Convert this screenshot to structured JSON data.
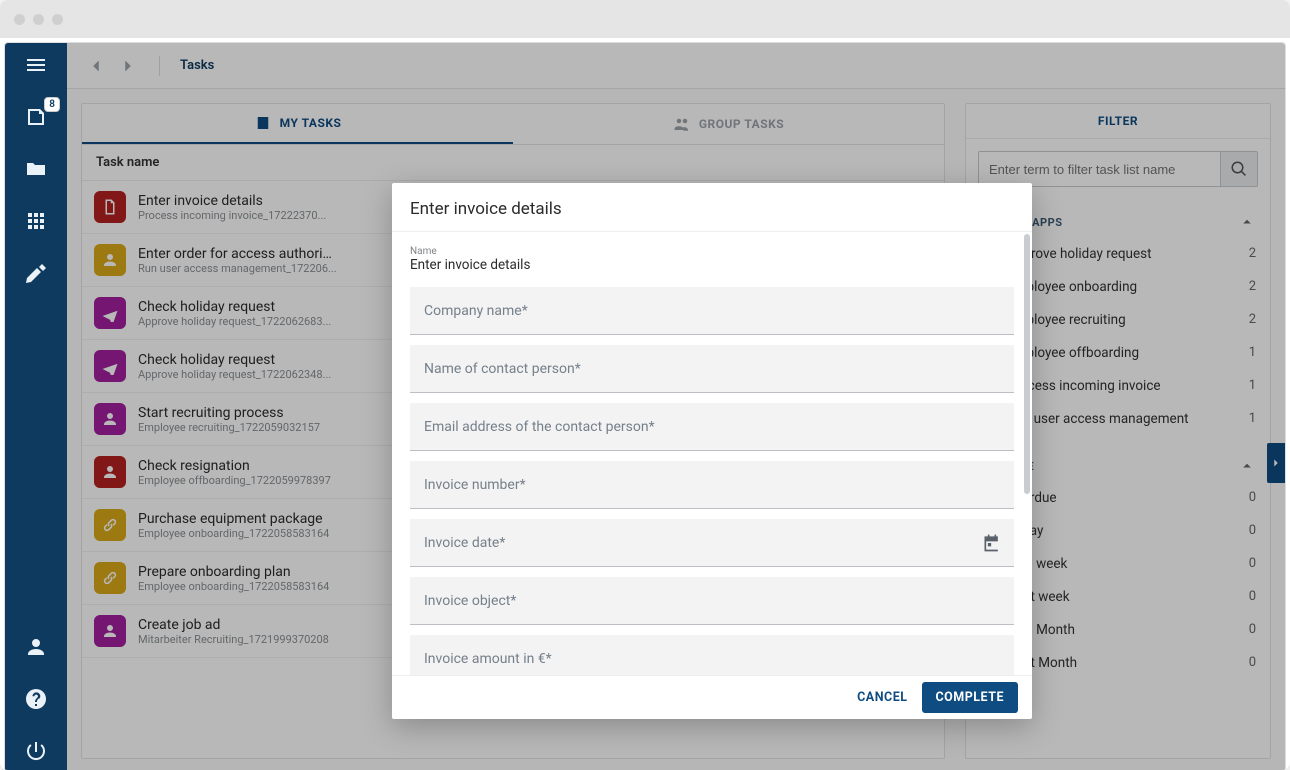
{
  "breadcrumb": "Tasks",
  "sidebar_badge": "8",
  "tabs": {
    "my_tasks": "MY TASKS",
    "group_tasks": "GROUP TASKS"
  },
  "column_header": "Task name",
  "tasks": [
    {
      "title": "Enter invoice details",
      "sub": "Process incoming invoice_17222370...",
      "color": "#b32121",
      "icon": "doc"
    },
    {
      "title": "Enter order for access authorizat...",
      "sub": "Run user access management_172206...",
      "color": "#d9a818",
      "icon": "user"
    },
    {
      "title": "Check holiday request",
      "sub": "Approve holiday request_1722062683...",
      "color": "#a11f9e",
      "icon": "plane"
    },
    {
      "title": "Check holiday request",
      "sub": "Approve holiday request_1722062348...",
      "color": "#a11f9e",
      "icon": "plane"
    },
    {
      "title": "Start recruiting process",
      "sub": "Employee recruiting_1722059032157",
      "color": "#a11f9e",
      "icon": "user"
    },
    {
      "title": "Check resignation",
      "sub": "Employee offboarding_1722059978397",
      "color": "#b32121",
      "icon": "user"
    },
    {
      "title": "Purchase equipment package",
      "sub": "Employee onboarding_1722058583164",
      "color": "#d9a818",
      "icon": "link"
    },
    {
      "title": "Prepare onboarding plan",
      "sub": "Employee onboarding_1722058583164",
      "color": "#d9a818",
      "icon": "link"
    },
    {
      "title": "Create job ad",
      "sub": "Mitarbeiter Recruiting_1721999370208",
      "color": "#a11f9e",
      "icon": "user"
    }
  ],
  "filter": {
    "header": "FILTER",
    "search_placeholder": "Enter term to filter task list name",
    "sections": {
      "processapps": {
        "title": "PROCESSAPPS",
        "items": [
          {
            "label": "Approve holiday request",
            "count": "2"
          },
          {
            "label": "Employee onboarding",
            "count": "2"
          },
          {
            "label": "Employee recruiting",
            "count": "2"
          },
          {
            "label": "Employee offboarding",
            "count": "1"
          },
          {
            "label": "Process incoming invoice",
            "count": "1"
          },
          {
            "label": "Run user access management",
            "count": "1"
          }
        ]
      },
      "due_date": {
        "title": "DUE DATE",
        "items": [
          {
            "label": "Overdue",
            "count": "0"
          },
          {
            "label": "Today",
            "count": "0"
          },
          {
            "label": "This week",
            "count": "0"
          },
          {
            "label": "Next week",
            "count": "0"
          },
          {
            "label": "This Month",
            "count": "0"
          },
          {
            "label": "Next Month",
            "count": "0"
          }
        ]
      }
    }
  },
  "modal": {
    "title": "Enter invoice details",
    "name_label": "Name",
    "name_value": "Enter invoice details",
    "fields": [
      {
        "placeholder": "Company name*"
      },
      {
        "placeholder": "Name of contact person*"
      },
      {
        "placeholder": "Email address of the contact person*"
      },
      {
        "placeholder": "Invoice number*"
      },
      {
        "placeholder": "Invoice date*",
        "calendar": true
      },
      {
        "placeholder": "Invoice object*"
      },
      {
        "placeholder": "Invoice amount in €*"
      }
    ],
    "cancel": "CANCEL",
    "complete": "COMPLETE"
  }
}
